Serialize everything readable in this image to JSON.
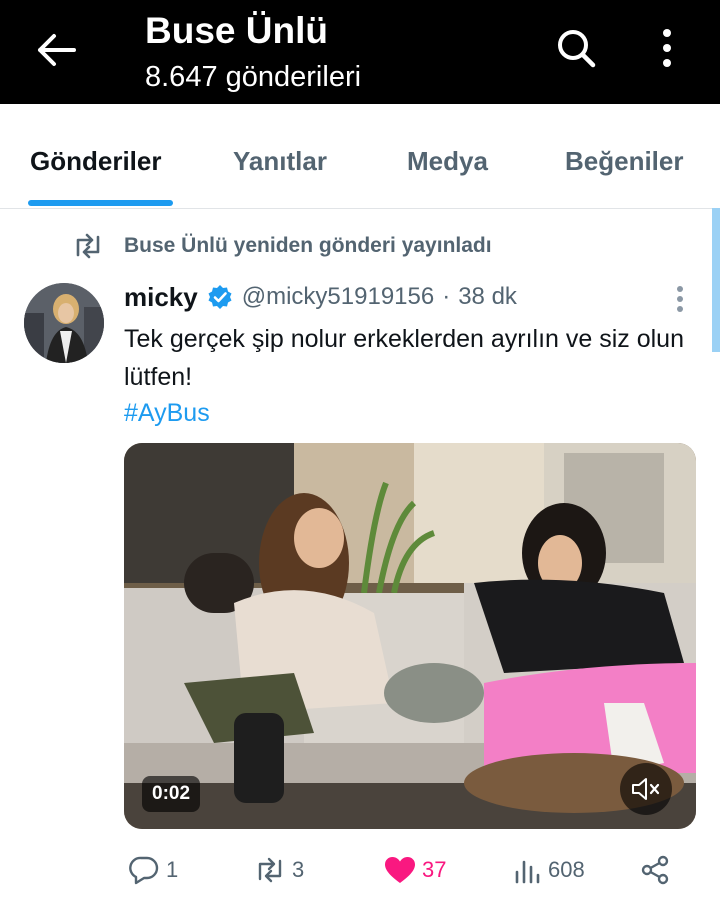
{
  "header": {
    "title": "Buse Ünlü",
    "subtitle": "8.647 gönderileri"
  },
  "tabs": [
    {
      "label": "Gönderiler",
      "active": true
    },
    {
      "label": "Yanıtlar",
      "active": false
    },
    {
      "label": "Medya",
      "active": false
    },
    {
      "label": "Beğeniler",
      "active": false
    }
  ],
  "post": {
    "repost_text": "Buse Ünlü yeniden gönderi yayınladı",
    "author_name": "micky",
    "author_handle": "@micky51919156",
    "separator": "·",
    "time": "38 dk",
    "text": "Tek gerçek şip nolur erkeklerden ayrılın ve siz olun lütfen!",
    "hashtag": "#AyBus",
    "media": {
      "duration": "0:02"
    },
    "actions": {
      "replies": "1",
      "reposts": "3",
      "likes": "37",
      "views": "608"
    }
  },
  "colors": {
    "accent": "#1d9bf0",
    "like": "#f91880",
    "muted_text": "#536471",
    "header_bg": "#000000"
  },
  "icons": {
    "back": "arrow-left-icon",
    "search": "search-icon",
    "more": "more-vertical-icon",
    "repost": "repost-icon",
    "verified": "verified-badge-icon",
    "mute": "volume-mute-icon",
    "reply": "reply-icon",
    "like": "heart-icon",
    "views": "views-chart-icon",
    "share": "share-icon"
  }
}
